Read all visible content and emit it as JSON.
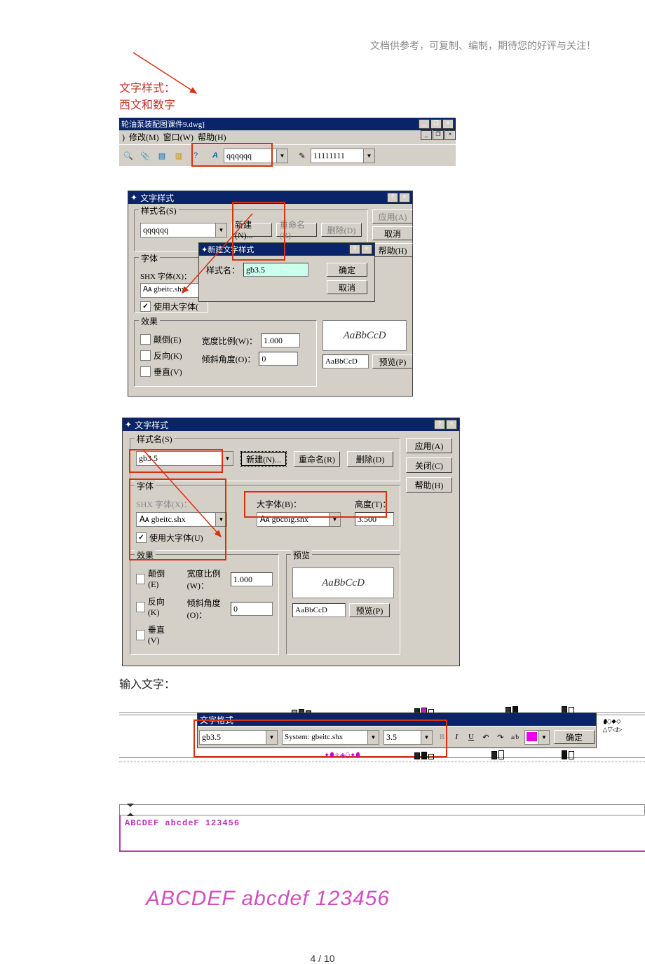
{
  "notice": "文档供参考，可复制、编制，期待您的好评与关注！",
  "heading1": "文字样式：",
  "heading2": "西文和数字",
  "titlebar1": "轮油泵装配图课件9.dwg]",
  "menu_modify": "修改(M)",
  "menu_window": "窗口(W)",
  "menu_help": "帮助(H)",
  "toolbar_style": "qqqqqq",
  "toolbar_dim": "11111111",
  "d1": {
    "title": "文字样式",
    "g_name": "样式名(S)",
    "combo_name": "qqqqqq",
    "btn_new": "新建(N)...",
    "btn_rename": "重命名(R)",
    "btn_delete": "删除(D)",
    "btn_apply": "应用(A)",
    "btn_cancel": "取消",
    "btn_help": "帮助(H)",
    "g_font": "字体",
    "shx_label": "SHX 字体(X)：",
    "shx_combo": "gbeitc.shx",
    "usebig": "使用大字体(",
    "g_eff": "效果",
    "upside": "颠倒(E)",
    "back": "反向(K)",
    "vert": "垂直(V)",
    "wscale_l": "宽度比例(W)：",
    "wscale": "1.000",
    "angle_l": "倾斜角度(O)：",
    "angle": "0",
    "prev": "AaBbCcD",
    "prev_in": "AaBbCcD",
    "btn_prev": "预览(P)"
  },
  "d1_sub": {
    "title": "新建文字样式",
    "name_l": "样式名：",
    "name": "gb3.5",
    "ok": "确定",
    "cancel": "取消"
  },
  "d2": {
    "title": "文字样式",
    "g_name": "样式名(S)",
    "combo_name": "gb3.5",
    "btn_new": "新建(N)...",
    "btn_rename": "重命名(R)",
    "btn_delete": "删除(D)",
    "btn_apply": "应用(A)",
    "btn_close": "关闭(C)",
    "btn_help": "帮助(H)",
    "g_font": "字体",
    "shx_label": "SHX 字体(X)：",
    "shx_combo": "gbeitc.shx",
    "big_label": "大字体(B)：",
    "big_combo": "gbcbig.shx",
    "h_label": "高度(T)：",
    "h_val": "3.500",
    "usebig": "使用大字体(U)",
    "g_eff": "效果",
    "upside": "颠倒(E)",
    "back": "反向(K)",
    "vert": "垂直(V)",
    "wscale_l": "宽度比例(W)：",
    "wscale": "1.000",
    "angle_l": "倾斜角度(O)：",
    "angle": "0",
    "g_prev": "预览",
    "prev": "AaBbCcD",
    "prev_in": "AaBbCcD",
    "btn_prev": "预览(P)"
  },
  "input_text_label": "输入文字：",
  "format": {
    "title": "文字格式",
    "style": "gb3.5",
    "font": "System: gbeitc.shx",
    "height": "3.5",
    "b": "B",
    "i": "I",
    "u": "U",
    "undo": "↶",
    "redo": "↷",
    "btn_ok": "确定"
  },
  "sample_text": "ABCDEF  abcdeF   123456",
  "large_sample": "ABCDEF  abcdef   123456",
  "page_num": "4 / 10"
}
